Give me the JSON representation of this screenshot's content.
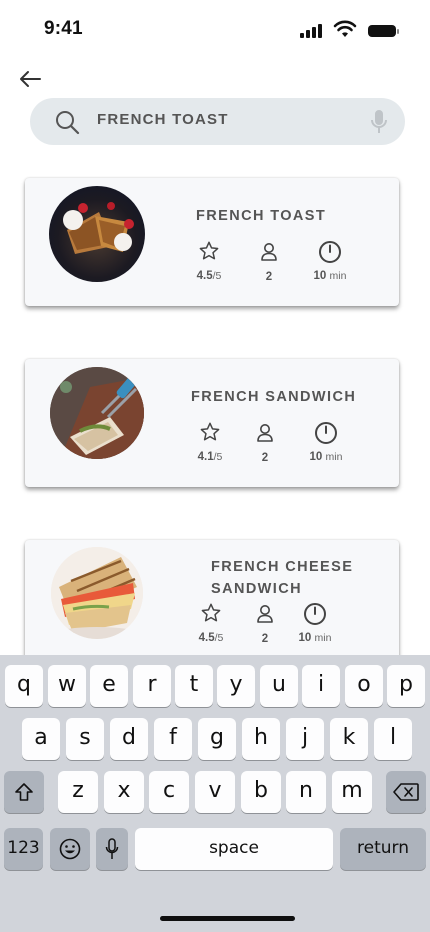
{
  "status": {
    "time": "9:41"
  },
  "search": {
    "query": "FRENCH TOAST"
  },
  "results": [
    {
      "title": "FRENCH TOAST",
      "rating": "4.5",
      "rating_max": "/5",
      "servings": "2",
      "time_value": "10",
      "time_unit": "min"
    },
    {
      "title": "FRENCH SANDWICH",
      "rating": "4.1",
      "rating_max": "/5",
      "servings": "2",
      "time_value": "10",
      "time_unit": "min"
    },
    {
      "title": "FRENCH CHEESE SANDWICH",
      "rating": "4.5",
      "rating_max": "/5",
      "servings": "2",
      "time_value": "10",
      "time_unit": "min"
    }
  ],
  "icons": {
    "back": "arrow-left-icon",
    "search": "search-icon",
    "mic": "microphone-icon",
    "rating": "star-icon",
    "servings": "person-icon",
    "time": "clock-icon"
  },
  "keyboard": {
    "row1": [
      "q",
      "w",
      "e",
      "r",
      "t",
      "y",
      "u",
      "i",
      "o",
      "p"
    ],
    "row2": [
      "a",
      "s",
      "d",
      "f",
      "g",
      "h",
      "j",
      "k",
      "l"
    ],
    "row3": [
      "z",
      "x",
      "c",
      "v",
      "b",
      "n",
      "m"
    ],
    "numbers_label": "123",
    "space_label": "space",
    "return_label": "return"
  },
  "colors": {
    "search_bg": "#e4e9ec",
    "card_bg": "#f7f8fa",
    "keyboard_bg": "#d1d4da"
  }
}
